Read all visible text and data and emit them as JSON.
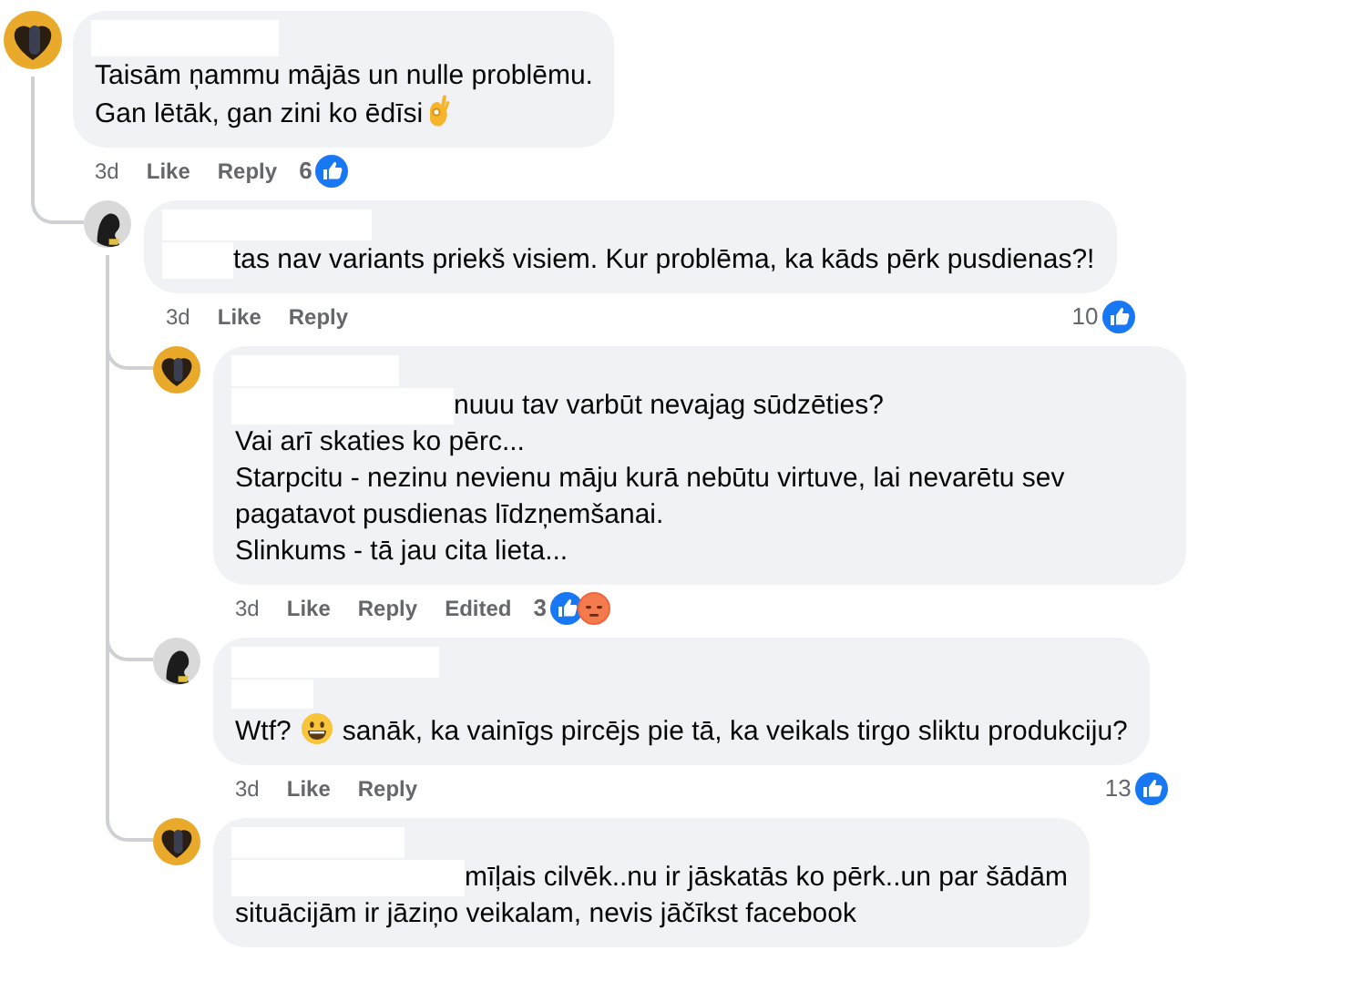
{
  "comments": [
    {
      "avatar": {
        "color": "#e9a92b"
      },
      "redaction": {
        "kind": "name"
      },
      "lines": [
        [
          {
            "kind": "text",
            "text": "Taisām ņammu mājās un nulle problēmu."
          }
        ],
        [
          {
            "kind": "text",
            "text": "Gan lētāk, gan zini ko ēdīsi"
          },
          {
            "kind": "ok-hand"
          }
        ]
      ],
      "meta": [
        {
          "kind": "time",
          "text": "3d"
        },
        {
          "kind": "link",
          "text": "Like"
        },
        {
          "kind": "link",
          "text": "Reply"
        }
      ],
      "reactions": {
        "at_end": false,
        "count": "6",
        "types": [
          {
            "kind": "like"
          }
        ]
      },
      "children": [
        {
          "avatar": {
            "color": "#d9d9d9"
          },
          "redaction": {
            "kind": "inline"
          },
          "lines": [
            [
              {
                "kind": "text",
                "text": "tas nav variants priekš visiem. Kur problēma, ka kāds pērk pusdienas?!"
              }
            ]
          ],
          "meta": [
            {
              "kind": "time",
              "text": "3d"
            },
            {
              "kind": "link",
              "text": "Like"
            },
            {
              "kind": "link",
              "text": "Reply"
            }
          ],
          "reactions": {
            "at_end": true,
            "count": "10",
            "types": [
              {
                "kind": "like"
              }
            ]
          },
          "children": [
            {
              "avatar": {
                "color": "#e9a92b"
              },
              "redaction": {
                "kind": "inline"
              },
              "lines": [
                [
                  {
                    "kind": "text",
                    "text": "nuuu tav varbūt nevajag sūdzēties?"
                  }
                ],
                [
                  {
                    "kind": "text",
                    "text": "Vai arī skaties ko pērc..."
                  }
                ],
                [
                  {
                    "kind": "text",
                    "text": "Starpcitu - nezinu nevienu māju kurā nebūtu virtuve, lai nevarētu sev pagatavot pusdienas līdzņemšanai."
                  }
                ],
                [
                  {
                    "kind": "text",
                    "text": "Slinkums - tā jau cita lieta..."
                  }
                ]
              ],
              "meta": [
                {
                  "kind": "time",
                  "text": "3d"
                },
                {
                  "kind": "link",
                  "text": "Like"
                },
                {
                  "kind": "link",
                  "text": "Reply"
                },
                {
                  "kind": "link",
                  "text": "Edited"
                }
              ],
              "reactions": {
                "at_end": false,
                "count": "3",
                "types": [
                  {
                    "kind": "like"
                  },
                  {
                    "kind": "angry"
                  }
                ]
              }
            },
            {
              "avatar": {
                "color": "#d9d9d9"
              },
              "redaction": {
                "kind": "stacked"
              },
              "lines": [
                [
                  {
                    "kind": "text",
                    "text": "Wtf?"
                  },
                  {
                    "kind": "grin"
                  },
                  {
                    "kind": "text",
                    "text": "sanāk, ka vainīgs pircējs pie tā, ka veikals tirgo sliktu produkciju?"
                  }
                ]
              ],
              "meta": [
                {
                  "kind": "time",
                  "text": "3d"
                },
                {
                  "kind": "link",
                  "text": "Like"
                },
                {
                  "kind": "link",
                  "text": "Reply"
                }
              ],
              "reactions": {
                "at_end": true,
                "count": "13",
                "types": [
                  {
                    "kind": "like"
                  }
                ]
              }
            },
            {
              "avatar": {
                "color": "#e9a92b"
              },
              "redaction": {
                "kind": "inline"
              },
              "lines": [
                [
                  {
                    "kind": "text",
                    "text": "mīļais cilvēk..nu ir jāskatās ko pērk..un par šādām"
                  }
                ],
                [
                  {
                    "kind": "text",
                    "text": "situācijām ir jāziņo veikalam, nevis jāčīkst facebook"
                  }
                ]
              ]
            }
          ]
        }
      ]
    }
  ]
}
